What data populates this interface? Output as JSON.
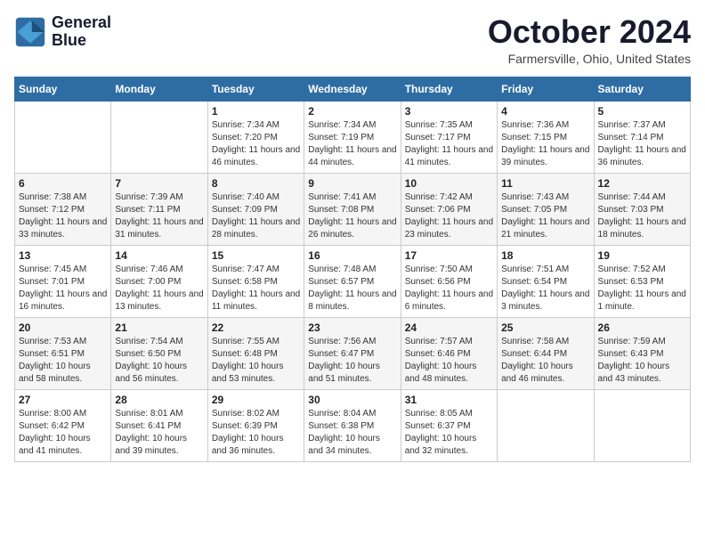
{
  "header": {
    "logo_line1": "General",
    "logo_line2": "Blue",
    "month": "October 2024",
    "location": "Farmersville, Ohio, United States"
  },
  "days_of_week": [
    "Sunday",
    "Monday",
    "Tuesday",
    "Wednesday",
    "Thursday",
    "Friday",
    "Saturday"
  ],
  "weeks": [
    [
      {
        "day": "",
        "info": ""
      },
      {
        "day": "",
        "info": ""
      },
      {
        "day": "1",
        "info": "Sunrise: 7:34 AM\nSunset: 7:20 PM\nDaylight: 11 hours and 46 minutes."
      },
      {
        "day": "2",
        "info": "Sunrise: 7:34 AM\nSunset: 7:19 PM\nDaylight: 11 hours and 44 minutes."
      },
      {
        "day": "3",
        "info": "Sunrise: 7:35 AM\nSunset: 7:17 PM\nDaylight: 11 hours and 41 minutes."
      },
      {
        "day": "4",
        "info": "Sunrise: 7:36 AM\nSunset: 7:15 PM\nDaylight: 11 hours and 39 minutes."
      },
      {
        "day": "5",
        "info": "Sunrise: 7:37 AM\nSunset: 7:14 PM\nDaylight: 11 hours and 36 minutes."
      }
    ],
    [
      {
        "day": "6",
        "info": "Sunrise: 7:38 AM\nSunset: 7:12 PM\nDaylight: 11 hours and 33 minutes."
      },
      {
        "day": "7",
        "info": "Sunrise: 7:39 AM\nSunset: 7:11 PM\nDaylight: 11 hours and 31 minutes."
      },
      {
        "day": "8",
        "info": "Sunrise: 7:40 AM\nSunset: 7:09 PM\nDaylight: 11 hours and 28 minutes."
      },
      {
        "day": "9",
        "info": "Sunrise: 7:41 AM\nSunset: 7:08 PM\nDaylight: 11 hours and 26 minutes."
      },
      {
        "day": "10",
        "info": "Sunrise: 7:42 AM\nSunset: 7:06 PM\nDaylight: 11 hours and 23 minutes."
      },
      {
        "day": "11",
        "info": "Sunrise: 7:43 AM\nSunset: 7:05 PM\nDaylight: 11 hours and 21 minutes."
      },
      {
        "day": "12",
        "info": "Sunrise: 7:44 AM\nSunset: 7:03 PM\nDaylight: 11 hours and 18 minutes."
      }
    ],
    [
      {
        "day": "13",
        "info": "Sunrise: 7:45 AM\nSunset: 7:01 PM\nDaylight: 11 hours and 16 minutes."
      },
      {
        "day": "14",
        "info": "Sunrise: 7:46 AM\nSunset: 7:00 PM\nDaylight: 11 hours and 13 minutes."
      },
      {
        "day": "15",
        "info": "Sunrise: 7:47 AM\nSunset: 6:58 PM\nDaylight: 11 hours and 11 minutes."
      },
      {
        "day": "16",
        "info": "Sunrise: 7:48 AM\nSunset: 6:57 PM\nDaylight: 11 hours and 8 minutes."
      },
      {
        "day": "17",
        "info": "Sunrise: 7:50 AM\nSunset: 6:56 PM\nDaylight: 11 hours and 6 minutes."
      },
      {
        "day": "18",
        "info": "Sunrise: 7:51 AM\nSunset: 6:54 PM\nDaylight: 11 hours and 3 minutes."
      },
      {
        "day": "19",
        "info": "Sunrise: 7:52 AM\nSunset: 6:53 PM\nDaylight: 11 hours and 1 minute."
      }
    ],
    [
      {
        "day": "20",
        "info": "Sunrise: 7:53 AM\nSunset: 6:51 PM\nDaylight: 10 hours and 58 minutes."
      },
      {
        "day": "21",
        "info": "Sunrise: 7:54 AM\nSunset: 6:50 PM\nDaylight: 10 hours and 56 minutes."
      },
      {
        "day": "22",
        "info": "Sunrise: 7:55 AM\nSunset: 6:48 PM\nDaylight: 10 hours and 53 minutes."
      },
      {
        "day": "23",
        "info": "Sunrise: 7:56 AM\nSunset: 6:47 PM\nDaylight: 10 hours and 51 minutes."
      },
      {
        "day": "24",
        "info": "Sunrise: 7:57 AM\nSunset: 6:46 PM\nDaylight: 10 hours and 48 minutes."
      },
      {
        "day": "25",
        "info": "Sunrise: 7:58 AM\nSunset: 6:44 PM\nDaylight: 10 hours and 46 minutes."
      },
      {
        "day": "26",
        "info": "Sunrise: 7:59 AM\nSunset: 6:43 PM\nDaylight: 10 hours and 43 minutes."
      }
    ],
    [
      {
        "day": "27",
        "info": "Sunrise: 8:00 AM\nSunset: 6:42 PM\nDaylight: 10 hours and 41 minutes."
      },
      {
        "day": "28",
        "info": "Sunrise: 8:01 AM\nSunset: 6:41 PM\nDaylight: 10 hours and 39 minutes."
      },
      {
        "day": "29",
        "info": "Sunrise: 8:02 AM\nSunset: 6:39 PM\nDaylight: 10 hours and 36 minutes."
      },
      {
        "day": "30",
        "info": "Sunrise: 8:04 AM\nSunset: 6:38 PM\nDaylight: 10 hours and 34 minutes."
      },
      {
        "day": "31",
        "info": "Sunrise: 8:05 AM\nSunset: 6:37 PM\nDaylight: 10 hours and 32 minutes."
      },
      {
        "day": "",
        "info": ""
      },
      {
        "day": "",
        "info": ""
      }
    ]
  ]
}
